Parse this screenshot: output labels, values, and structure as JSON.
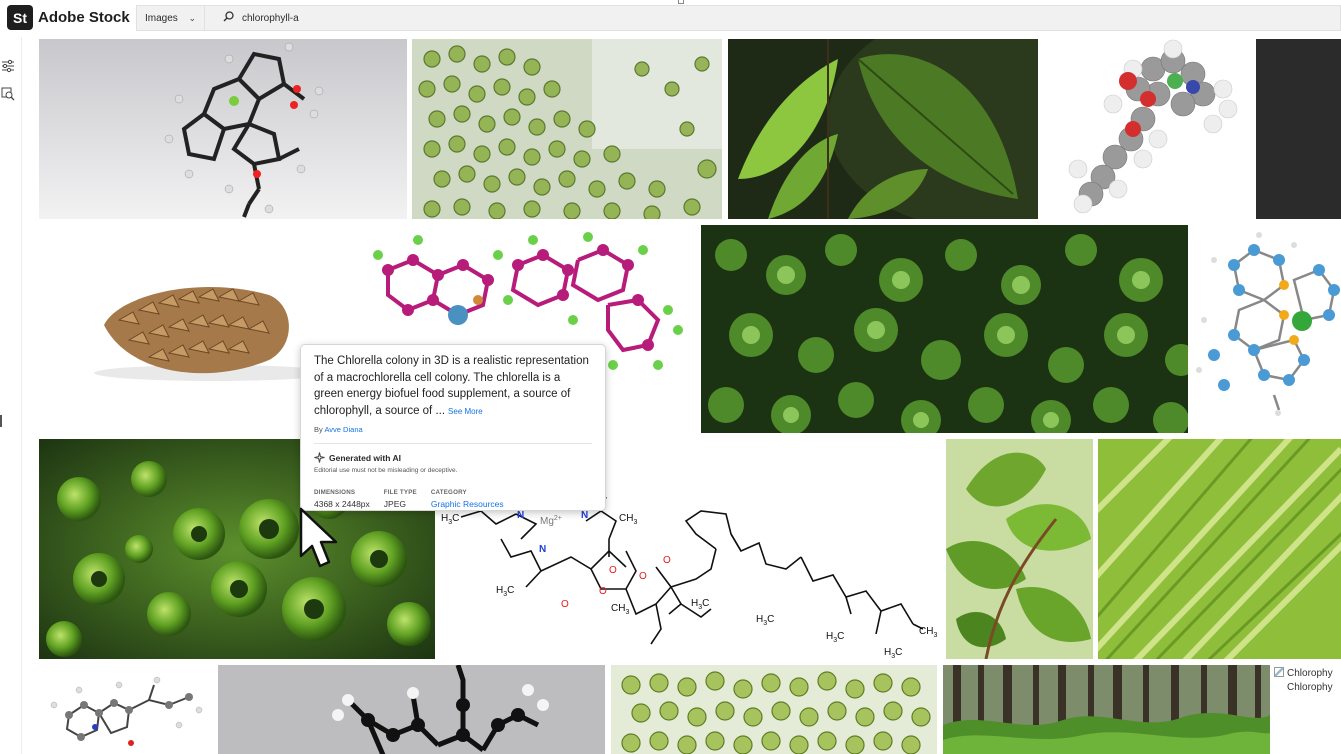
{
  "app": {
    "logo_mark": "St",
    "name": "Adobe Stock"
  },
  "search": {
    "type_selected": "Images",
    "query": "chlorophyll-a"
  },
  "icons": {
    "search": "magnifier-icon",
    "filters": "sliders-icon",
    "visual_search": "image-search-icon",
    "cursor": "mouse-pointer-icon"
  },
  "popover": {
    "description": "The Chlorella colony in 3D is a realistic representation of a macrochlorella cell colony. The chlorella is a green energy biofuel food supplement, a source of chlorophyll, a source of ...",
    "see_more": "See More",
    "by_prefix": "By",
    "author": "Avve Diana",
    "ai_badge": "Generated with AI",
    "ai_note": "Editorial use must not be misleading or deceptive.",
    "dimensions_label": "DIMENSIONS",
    "dimensions_value": "4368 x 2448px",
    "filetype_label": "FILE TYPE",
    "filetype_value": "JPEG",
    "category_label": "CATEGORY",
    "category_value": "Graphic Resources"
  },
  "structure_labels": {
    "mg": "Mg",
    "mg_charge": "2+",
    "h3c": "H",
    "sub3": "3",
    "c": "C",
    "ch3_c": "CH",
    "n": "N",
    "o": "O"
  },
  "broken_image": {
    "line1": "Chlorophy",
    "line2": "Chlorophy"
  },
  "colors": {
    "accent": "#1473e6",
    "logo_bg": "#1e1e1e"
  }
}
